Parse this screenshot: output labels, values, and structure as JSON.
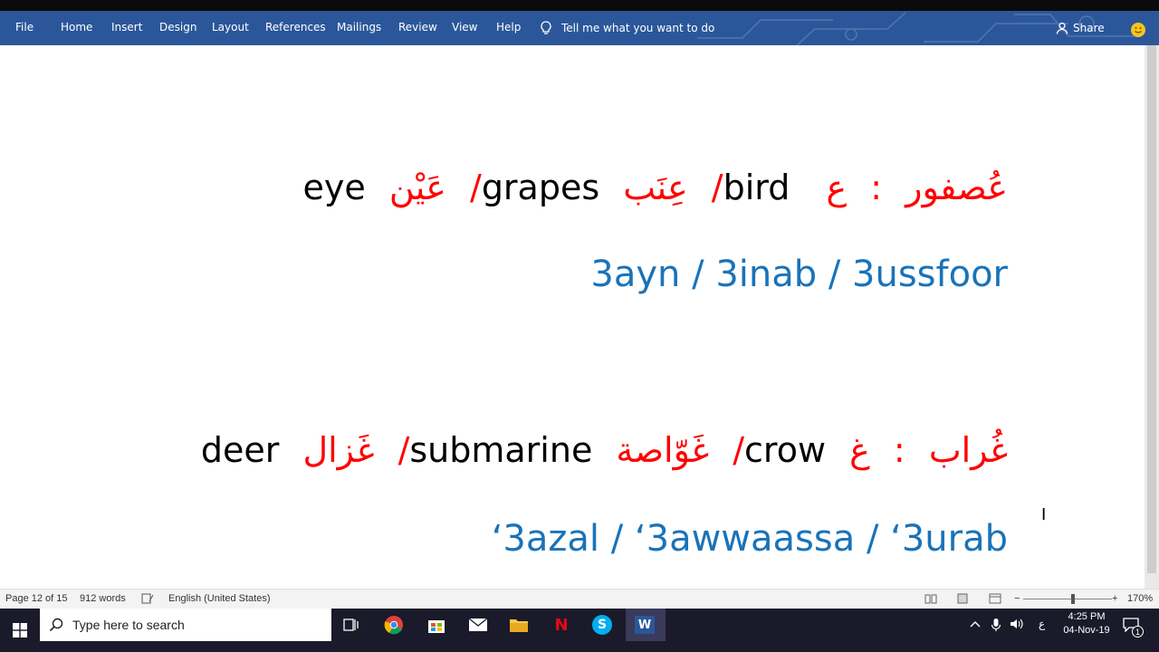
{
  "ribbon": {
    "menu": [
      "File",
      "Home",
      "Insert",
      "Design",
      "Layout",
      "References",
      "Mailings",
      "Review",
      "View",
      "Help"
    ],
    "tell_me": "Tell me what you want to do",
    "share": "Share",
    "color": "#2b579a"
  },
  "document": {
    "letter1": {
      "arabic_letter": "ع",
      "colon": ":",
      "arabic_word1": "عُصفور",
      "english1": "bird",
      "arabic_word2": "عِنَب",
      "english2": "grapes",
      "arabic_word3": "عَيْن",
      "english3": "eye",
      "separator": "/",
      "transliteration": "3ayn / 3inab / 3ussfoor"
    },
    "letter2": {
      "arabic_letter": "غ",
      "colon": ":",
      "arabic_word1": "غُراب",
      "english1": "crow",
      "arabic_word2": "غَوّاصة",
      "english2": "submarine",
      "arabic_word3": "غَزال",
      "english3": "deer",
      "separator": "/",
      "transliteration": "‘3azal / ‘3awwaassa / ‘3urab"
    },
    "colors": {
      "arabic": "#ff0000",
      "english": "#000000",
      "transliteration": "#1a73b8"
    }
  },
  "status_bar": {
    "page": "Page 12 of 15",
    "words": "912 words",
    "language": "English (United States)",
    "zoom_minus": "−",
    "zoom_plus": "+",
    "zoom": "170%"
  },
  "taskbar": {
    "search_placeholder": "Type here to search",
    "icons": [
      "task-view-icon",
      "chrome-icon",
      "store-icon",
      "mail-icon",
      "file-explorer-icon",
      "netflix-icon",
      "skype-icon",
      "word-icon"
    ],
    "netflix_label": "N",
    "skype_label": "S",
    "word_label": "W",
    "input_language": "ع",
    "time": "4:25 PM",
    "date": "04-Nov-19",
    "notification_count": "1"
  }
}
